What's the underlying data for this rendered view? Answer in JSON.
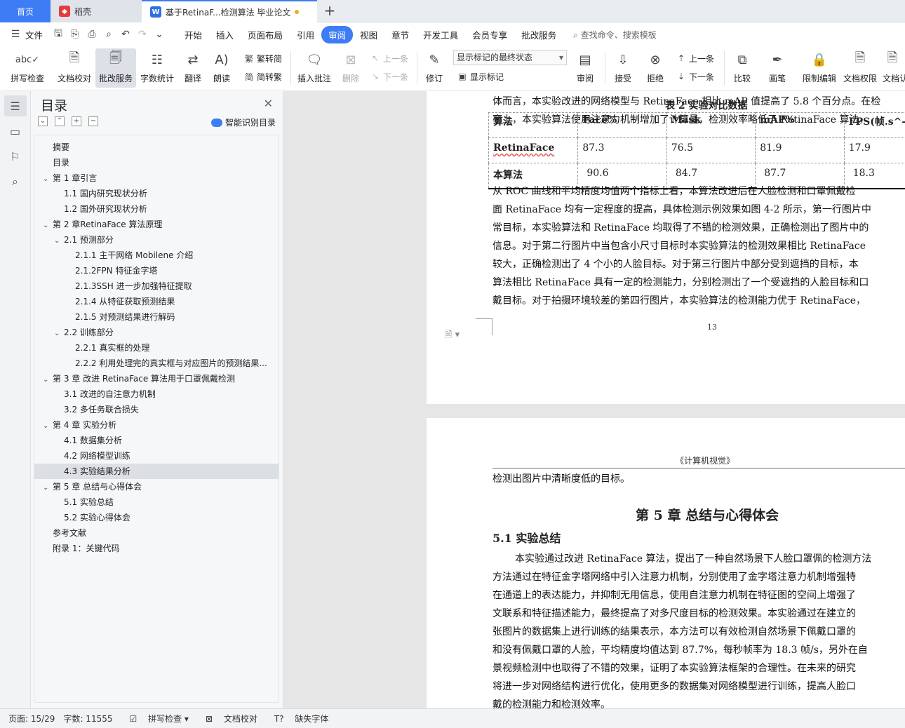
{
  "tabs": {
    "home": "首页",
    "daoke": "稻壳",
    "doc": "基于RetinaF...检测算法 毕业论文"
  },
  "menu": {
    "file": "文件",
    "items": [
      "开始",
      "插入",
      "页面布局",
      "引用",
      "审阅",
      "视图",
      "章节",
      "开发工具",
      "会员专享",
      "批改服务"
    ],
    "active": "审阅",
    "search": "查找命令、搜索模板"
  },
  "ribbon": {
    "spell_check": "拼写检查",
    "doc_check": "文档校对",
    "revise_service": "批改服务",
    "word_count": "字数统计",
    "translate": "翻译",
    "read_aloud": "朗读",
    "to_trad": "繁转简",
    "to_simp": "简转繁",
    "insert_comment": "插入批注",
    "delete": "删除",
    "prev": "上一条",
    "next": "下一条",
    "track": "修订",
    "markup_state": "显示标记的最终状态",
    "show_markup": "显示标记",
    "review": "审阅",
    "accept": "接受",
    "reject": "拒绝",
    "prev2": "上一条",
    "next2": "下一条",
    "compare": "比较",
    "pen": "画笔",
    "restrict": "限制编辑",
    "doc_perm": "文档权限",
    "doc_cert": "文档认"
  },
  "toc": {
    "title": "目录",
    "smart": "智能识别目录",
    "items": [
      {
        "text": "摘要",
        "level": 0,
        "arrow": ""
      },
      {
        "text": "目录",
        "level": 0,
        "arrow": ""
      },
      {
        "text": "第 1 章引言",
        "level": 0,
        "arrow": "v"
      },
      {
        "text": "1.1 国内研究现状分析",
        "level": 1,
        "arrow": ""
      },
      {
        "text": "1.2 国外研究现状分析",
        "level": 1,
        "arrow": ""
      },
      {
        "text": "第 2 章RetinaFace 算法原理",
        "level": 0,
        "arrow": "v"
      },
      {
        "text": "2.1 预测部分",
        "level": 1,
        "arrow": "v"
      },
      {
        "text": "2.1.1 主干网络 Mobilene 介绍",
        "level": 2,
        "arrow": ""
      },
      {
        "text": "2.1.2FPN 特征金字塔",
        "level": 2,
        "arrow": ""
      },
      {
        "text": "2.1.3SSH 进一步加强特征提取",
        "level": 2,
        "arrow": ""
      },
      {
        "text": "2.1.4 从特征获取预测结果",
        "level": 2,
        "arrow": ""
      },
      {
        "text": "2.1.5 对预测结果进行解码",
        "level": 2,
        "arrow": ""
      },
      {
        "text": "2.2 训练部分",
        "level": 1,
        "arrow": "v"
      },
      {
        "text": "2.2.1 真实框的处理",
        "level": 2,
        "arrow": ""
      },
      {
        "text": "2.2.2 利用处理完的真实框与对应图片的预测结果...",
        "level": 2,
        "arrow": ""
      },
      {
        "text": "第 3 章 改进 RetinaFace 算法用于口罩佩戴检测",
        "level": 0,
        "arrow": "v"
      },
      {
        "text": "3.1 改进的自注意力机制",
        "level": 1,
        "arrow": ""
      },
      {
        "text": "3.2 多任务联合损失",
        "level": 1,
        "arrow": ""
      },
      {
        "text": "第 4 章 实验分析",
        "level": 0,
        "arrow": "v"
      },
      {
        "text": "4.1 数据集分析",
        "level": 1,
        "arrow": ""
      },
      {
        "text": "4.2 网络模型训练",
        "level": 1,
        "arrow": ""
      },
      {
        "text": "4.3 实验结果分析",
        "level": 1,
        "arrow": "",
        "selected": true
      },
      {
        "text": "第 5 章 总结与心得体会",
        "level": 0,
        "arrow": "v"
      },
      {
        "text": "5.1 实验总结",
        "level": 1,
        "arrow": ""
      },
      {
        "text": "5.2 实验心得体会",
        "level": 1,
        "arrow": ""
      },
      {
        "text": "参考文献",
        "level": 0,
        "arrow": ""
      },
      {
        "text": "附录 1：关键代码",
        "level": 0,
        "arrow": ""
      }
    ]
  },
  "page1": {
    "line_a": "体而言，本实验改进的网络模型与 RetinaFace 相比 mAP 值提高了 5.8 个百分点。在检",
    "line_b": "率上，本实验算法使用注意力机制增加了计算量，检测效率略低于 RetinaFace 算法。",
    "table_caption": "表 2 实验对比数据",
    "table_header": [
      "算法",
      "Face%",
      "Mask",
      "mAP%",
      "FPS(帧.s^-1"
    ],
    "table_rows": [
      [
        "RetinaFace",
        "87.3",
        "76.5",
        "81.9",
        "17.9"
      ],
      [
        "本算法",
        "90.6",
        "84.7",
        "87.7",
        "18.3"
      ]
    ],
    "para": [
      "从 ROC 曲线和平均精度均值两个指标上看，本算法改进后在人脸检测和口罩佩戴检",
      "面 RetinaFace 均有一定程度的提高，具体检测示例效果如图 4-2 所示，第一行图片中",
      "常目标，本实验算法和 RetinaFace 均取得了不错的检测效果，正确检测出了图片中的",
      "信息。对于第二行图片中当包含小尺寸目标时本实验算法的检测效果相比 RetinaFace",
      "较大，正确检测出了 4 个小的人脸目标。对于第三行图片中部分受到遮挡的目标，本",
      "算法相比 RetinaFace 具有一定的检测能力，分别检测出了一个受遮挡的人脸目标和口",
      "戴目标。对于拍摄环境较差的第四行图片，本实验算法的检测能力优于 RetinaFace，"
    ],
    "page_number": "13"
  },
  "page2": {
    "header": "《计算机视觉》",
    "first_line": "检测出图片中清晰度低的目标。",
    "chapter_title": "第 5 章  总结与心得体会",
    "section_title": "5.1 实验总结",
    "para": [
      "本实验通过改进 RetinaFace 算法，提出了一种自然场景下人脸口罩佩的检测方法",
      "方法通过在特征金字塔网络中引入注意力机制，分别使用了金字塔注意力机制增强特",
      "在通道上的表达能力，并抑制无用信息，使用自注意力机制在特征图的空间上增强了",
      "文联系和特征描述能力，最终提高了对多尺度目标的检测效果。本实验通过在建立的",
      "张图片的数据集上进行训练的结果表示，本方法可以有效检测自然场景下佩戴口罩的",
      "和没有佩戴口罩的人脸，平均精度均值达到 87.7%，每秒帧率为 18.3 帧/s，另外在自",
      "景视频检测中也取得了不错的效果，证明了本实验算法框架的合理性。在未来的研究",
      "将进一步对网络结构进行优化，使用更多的数据集对网络模型进行训练，提高人脸口",
      "戴的检测能力和检测效率。"
    ]
  },
  "status": {
    "page": "页面: 15/29",
    "words": "字数: 11555",
    "spell": "拼写检查",
    "proof": "文档校对",
    "missing_font": "缺失字体"
  }
}
